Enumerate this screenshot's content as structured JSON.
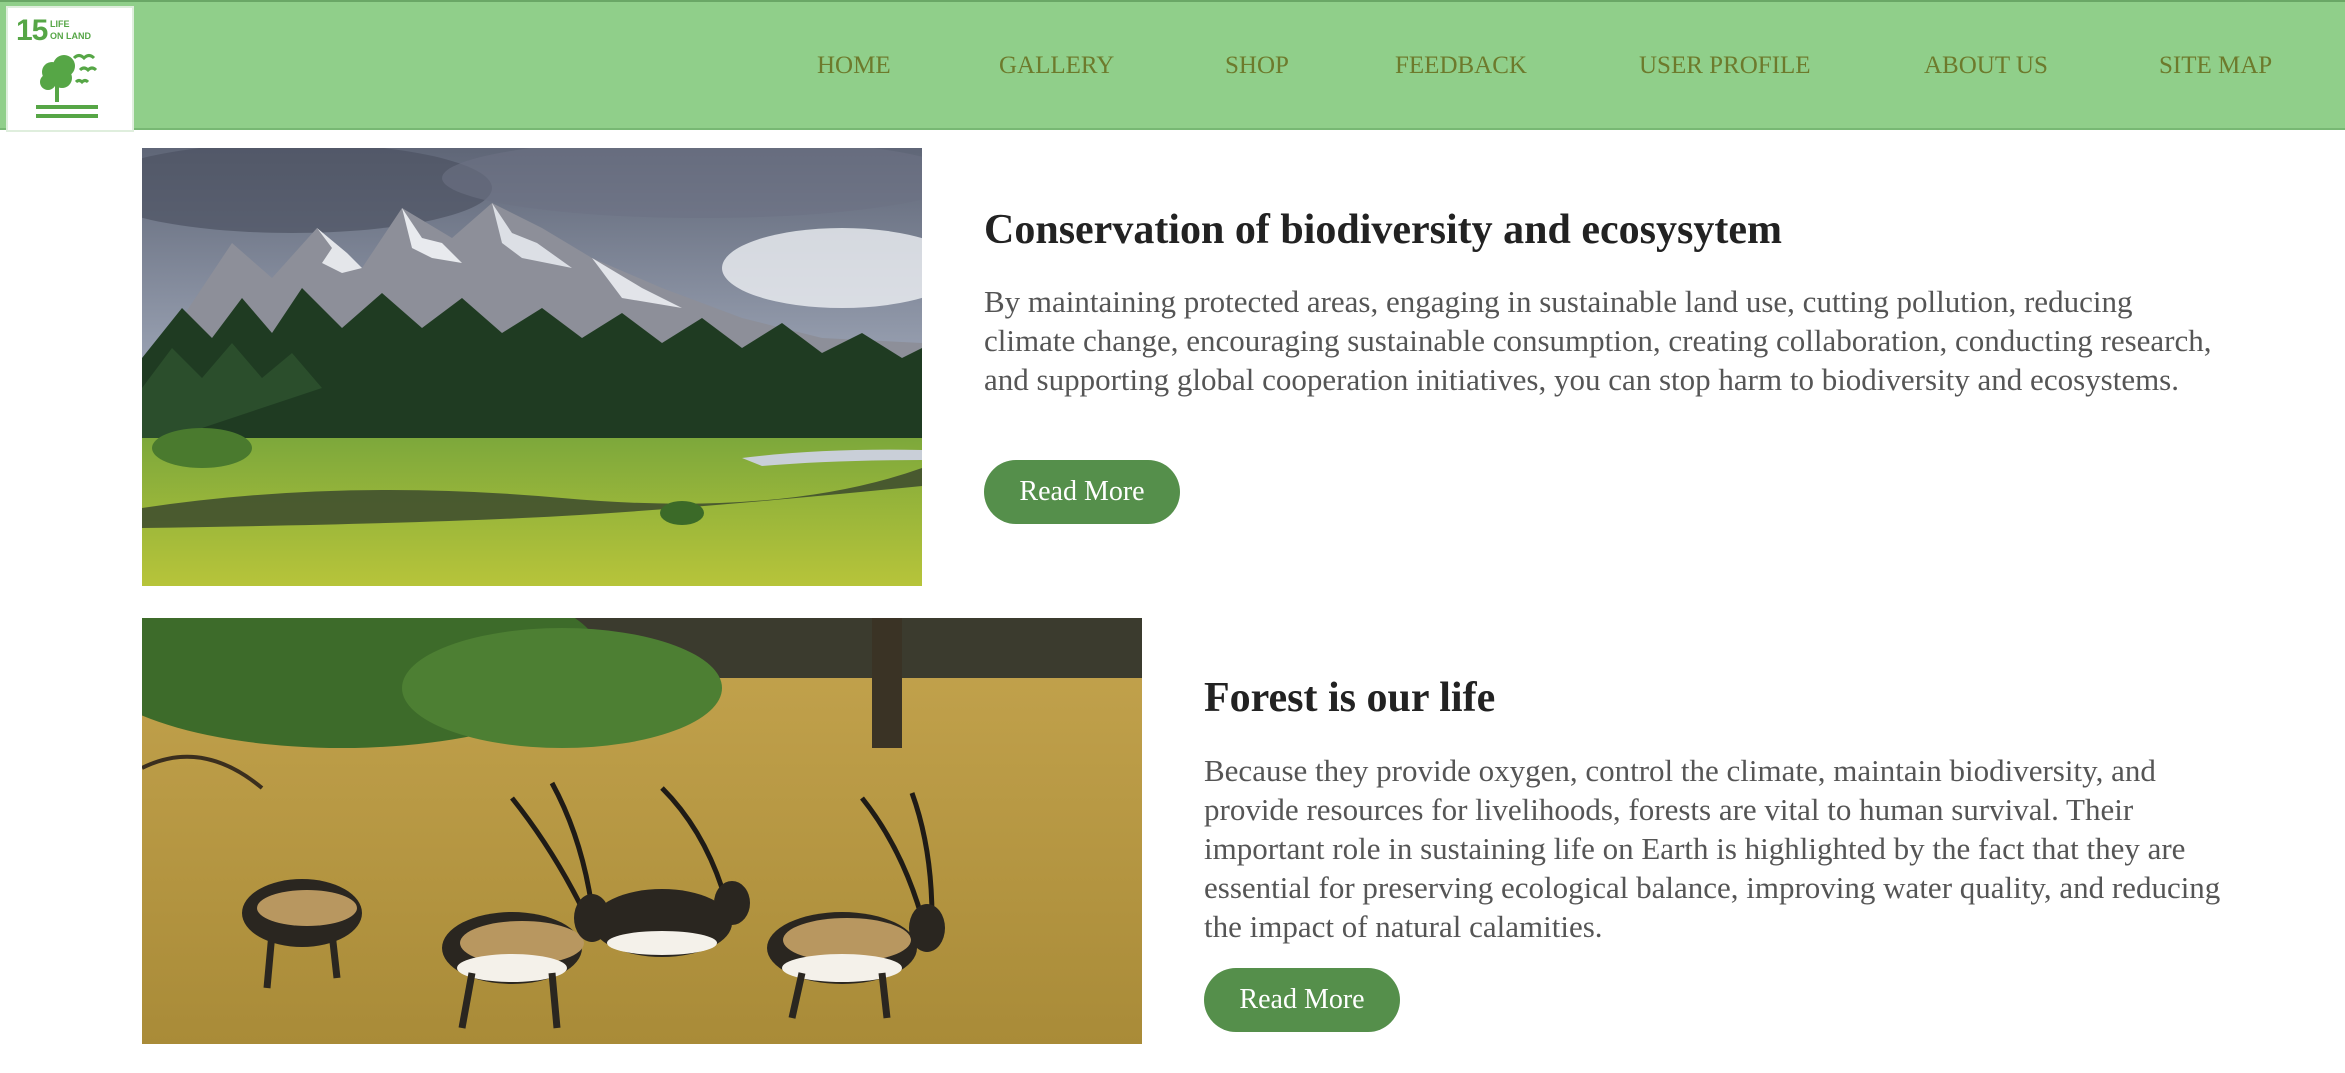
{
  "logo": {
    "number": "15",
    "title_line1": "LIFE",
    "title_line2": "ON LAND",
    "icon": "tree-birds-icon",
    "color": "#56a646"
  },
  "nav": {
    "items": [
      {
        "label": "HOME"
      },
      {
        "label": "GALLERY"
      },
      {
        "label": "SHOP"
      },
      {
        "label": "FEEDBACK"
      },
      {
        "label": "USER PROFILE"
      },
      {
        "label": "ABOUT US"
      },
      {
        "label": "SITE MAP"
      }
    ],
    "background": "#90cf8a",
    "link_color": "#6d7a2c"
  },
  "articles": [
    {
      "image": "mountain-forest-landscape-photo",
      "title": "Conservation of biodiversity and ecosysytem",
      "text": "By maintaining protected areas, engaging in sustainable land use, cutting pollution, reducing climate change, encouraging sustainable consumption, creating collaboration, conducting research, and supporting global cooperation initiatives, you can stop harm to biodiversity and ecosystems.",
      "button": "Read More"
    },
    {
      "image": "antelope-herd-grassland-photo",
      "title": "Forest is our life",
      "text": "Because they provide oxygen, control the climate, maintain biodiversity, and provide resources for livelihoods, forests are vital to human survival. Their important role in sustaining life on Earth is highlighted by the fact that they are essential for preserving ecological balance, improving water quality, and reducing the impact of natural calamities.",
      "button": "Read More"
    }
  ],
  "accent_color": "#558f4b"
}
